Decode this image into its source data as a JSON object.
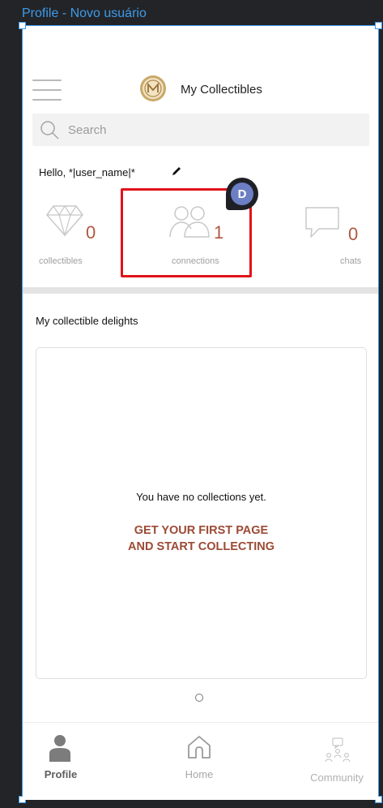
{
  "frame": {
    "title": "Profile - Novo usuário"
  },
  "header": {
    "title": "My Collectibles"
  },
  "search": {
    "placeholder": "Search"
  },
  "greeting": {
    "text": "Hello, *|user_name|*"
  },
  "avatar": {
    "letter": "D"
  },
  "stats": [
    {
      "count": "0",
      "label": "collectibles",
      "icon": "diamond-icon"
    },
    {
      "count": "1",
      "label": "connections",
      "icon": "people-icon"
    },
    {
      "count": "0",
      "label": "chats",
      "icon": "chat-bubble-icon"
    }
  ],
  "section": {
    "title": "My collectible delights"
  },
  "card": {
    "empty_text": "You have no collections yet.",
    "cta_line1": "GET YOUR FIRST PAGE",
    "cta_line2": "AND START COLLECTING"
  },
  "nav": [
    {
      "label": "Profile",
      "icon": "person-icon",
      "active": true
    },
    {
      "label": "Home",
      "icon": "home-icon",
      "active": false
    },
    {
      "label": "Community",
      "icon": "community-icon",
      "active": false
    }
  ],
  "colors": {
    "accent": "#b1573f",
    "cta": "#9c4a35",
    "selection": "#3d9be9",
    "highlight_box": "#e0131b"
  }
}
